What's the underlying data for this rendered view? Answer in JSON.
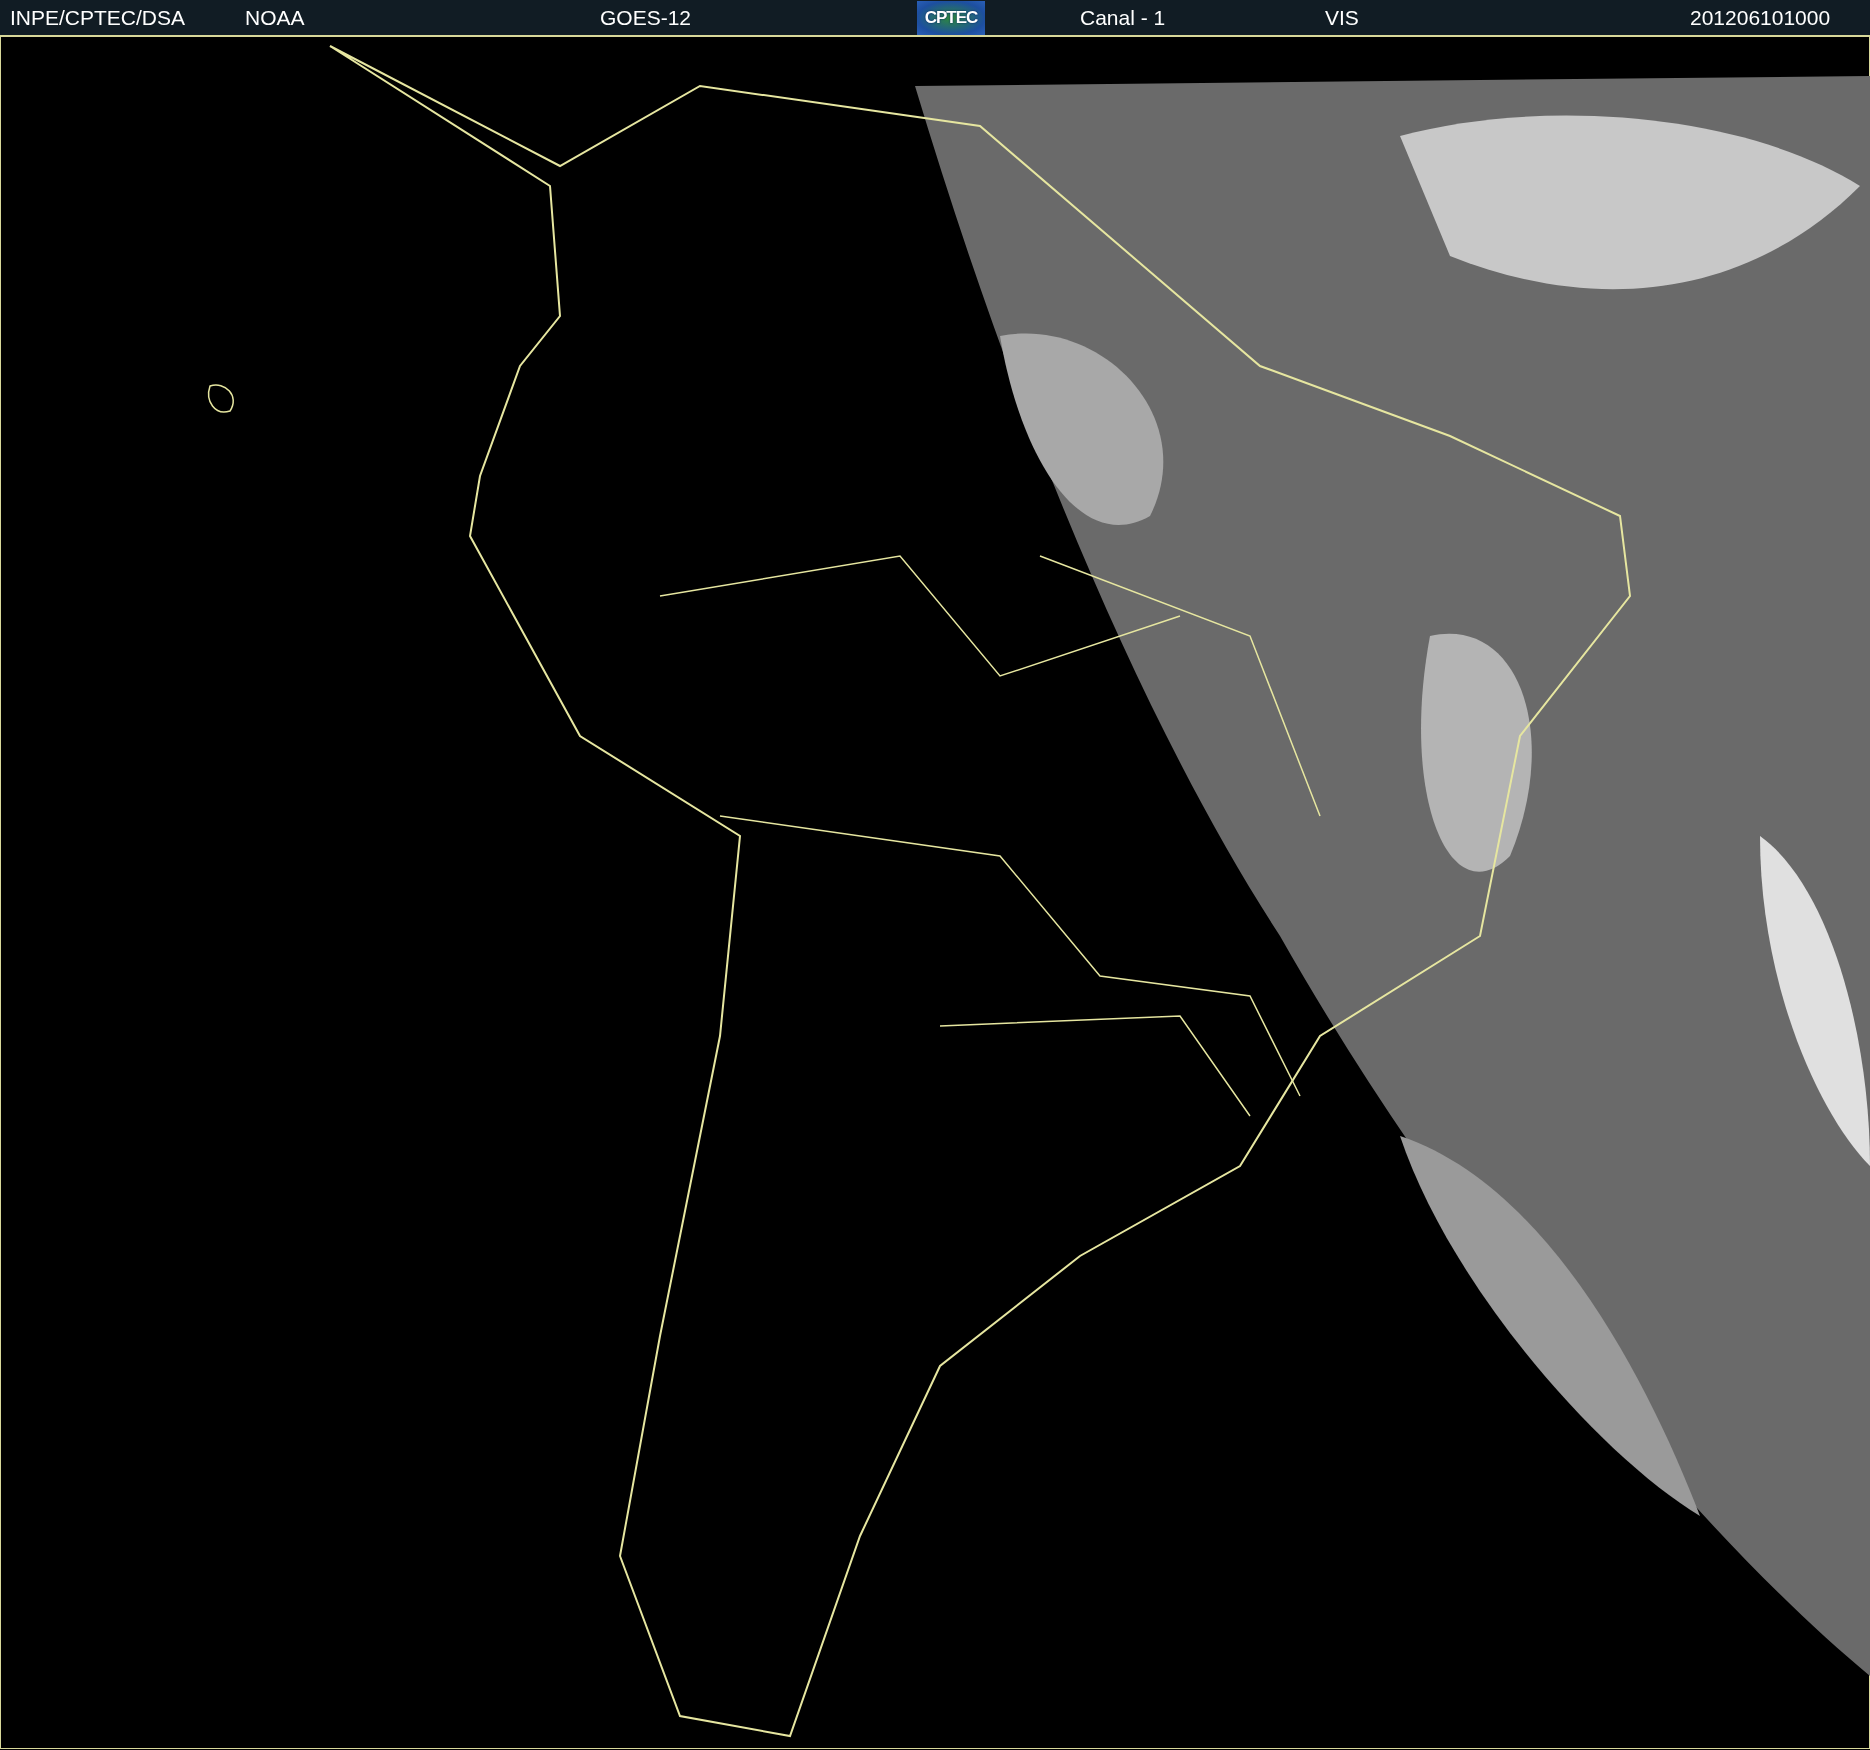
{
  "header": {
    "items": [
      {
        "kind": "text",
        "text": "INPE/CPTEC/DSA"
      },
      {
        "kind": "text",
        "text": "NOAA"
      },
      {
        "kind": "text",
        "text": "GOES-12"
      },
      {
        "kind": "logo",
        "text": "CPTEC"
      },
      {
        "kind": "text",
        "text": "Canal - 1"
      },
      {
        "kind": "text",
        "text": "VIS"
      },
      {
        "kind": "text",
        "text": "201206101000"
      }
    ]
  }
}
